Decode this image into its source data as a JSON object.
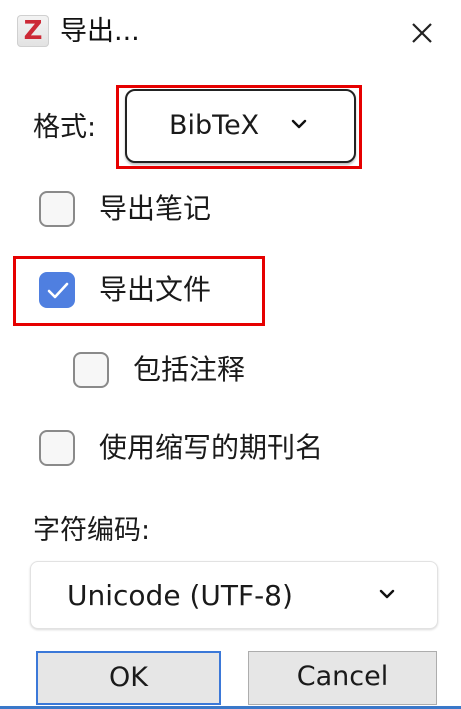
{
  "window": {
    "title": "导出...",
    "app_icon_letter": "Z",
    "close_icon": "close-icon"
  },
  "format": {
    "label": "格式:",
    "selected": "BibTeX"
  },
  "options": {
    "export_notes": {
      "label": "导出笔记",
      "checked": false
    },
    "export_files": {
      "label": "导出文件",
      "checked": true
    },
    "include_annotations": {
      "label": "包括注释",
      "checked": false
    },
    "abbreviated_journal": {
      "label": "使用缩写的期刊名",
      "checked": false
    }
  },
  "encoding": {
    "label": "字符编码:",
    "selected": "Unicode (UTF-8)"
  },
  "buttons": {
    "ok": "OK",
    "cancel": "Cancel"
  },
  "colors": {
    "accent": "#4f7fe0",
    "highlight": "#e60000",
    "app_icon": "#cc2936"
  }
}
